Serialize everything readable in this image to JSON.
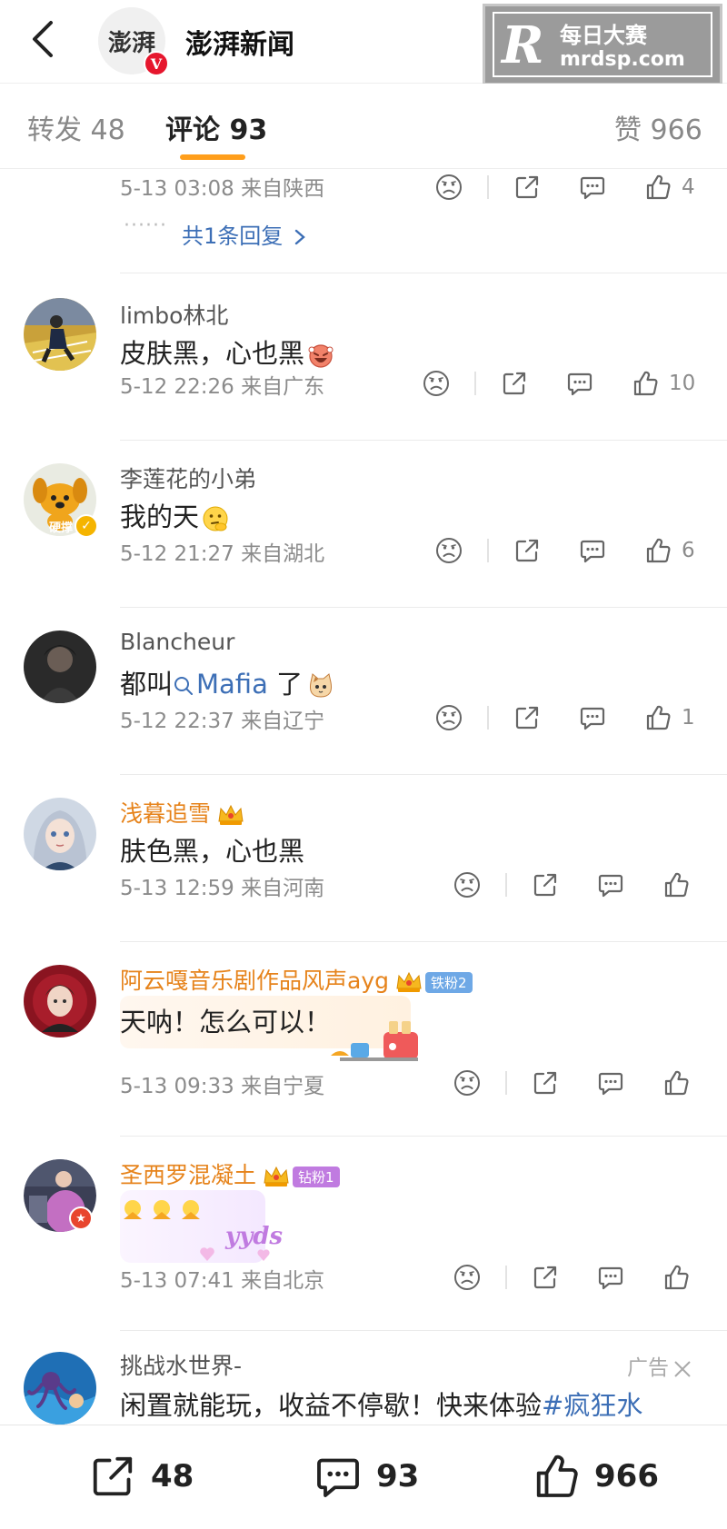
{
  "header": {
    "title": "澎湃新闻",
    "logo_text": "澎湃",
    "verified": "V"
  },
  "watermark": {
    "letter": "R",
    "line1": "每日大赛",
    "line2": "mrdsp.com"
  },
  "tabs": [
    {
      "label": "转发 48"
    },
    {
      "label": "评论 93"
    },
    {
      "label": "赞 966"
    }
  ],
  "top_comment": {
    "meta": "5-13 03:08 来自陕西",
    "likes": "4",
    "reply_link": "共1条回复",
    "dots": "······"
  },
  "comments": [
    {
      "name": "limbo林北",
      "text": "皮肤黑，心也黑",
      "meta": "5-12 22:26 来自广东",
      "likes": "10"
    },
    {
      "name": "李莲花的小弟",
      "text": "我的天",
      "meta": "5-12 21:27 来自湖北",
      "likes": "6",
      "avatar_label": "硬撑"
    },
    {
      "name": "Blancheur",
      "text_pre": "都叫",
      "mention": "Mafia",
      "text_post": " 了",
      "meta": "5-12 22:37 来自辽宁",
      "likes": "1"
    },
    {
      "name": "浅暮追雪",
      "text": "肤色黑，心也黑",
      "meta": "5-13 12:59 来自河南",
      "likes": ""
    },
    {
      "name": "阿云嘎音乐剧作品风声ayg",
      "badge": "铁粉2",
      "text": "天呐！怎么可以！",
      "meta": "5-13 09:33 来自宁夏",
      "likes": ""
    },
    {
      "name": "圣西罗混凝土",
      "badge": "钻粉1",
      "sticker": "yyds",
      "meta": "5-13 07:41 来自北京",
      "likes": ""
    },
    {
      "name": "挑战水世界-",
      "ad_label": "广告",
      "text_pre": "闲置就能玩，收益不停歇！快来体验",
      "hashtag": "#疯狂水"
    }
  ],
  "bottom_bar": {
    "repost": "48",
    "comment": "93",
    "like": "966"
  },
  "colors": {
    "accent": "#ff9e1b",
    "gold_name": "#e6831b",
    "link": "#3d6fb6",
    "verified": "#e6162d"
  }
}
